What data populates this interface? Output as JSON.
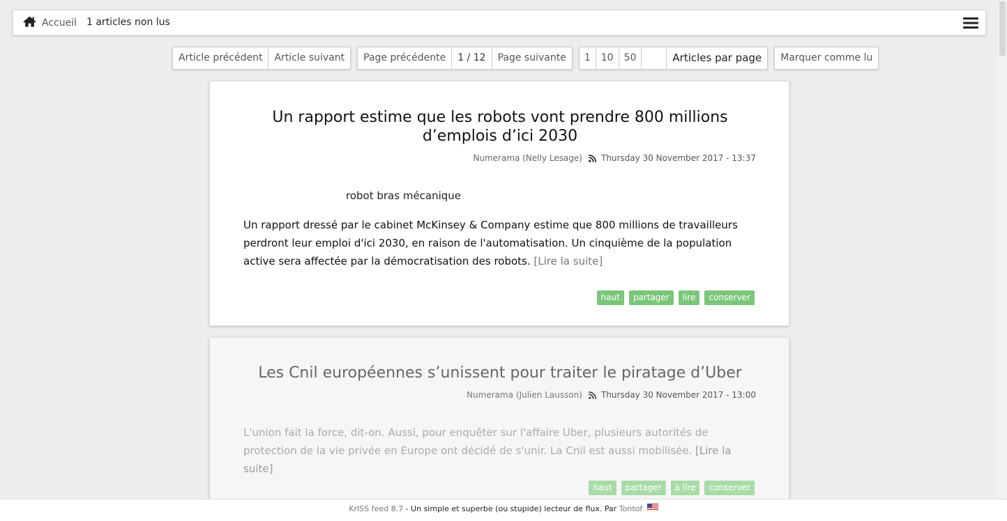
{
  "nav": {
    "home_label": "Accueil",
    "unread_label": "1 articles non lus"
  },
  "toolbar": {
    "prev_article": "Article précédent",
    "next_article": "Article suivant",
    "prev_page": "Page précédente",
    "page_indicator": "1 / 12",
    "next_page": "Page suivante",
    "per_page_options": [
      "1",
      "10",
      "50"
    ],
    "per_page_value": "",
    "per_page_label": "Articles par page",
    "mark_read": "Marquer comme lu"
  },
  "articles": [
    {
      "title": "Un rapport estime que les robots vont prendre 800 millions d’emplois d’ici 2030",
      "source": "Numerama (Nelly Lesage)",
      "date": "Thursday 30 November 2017 - 13:37",
      "image_alt": "robot bras mécanique",
      "text": "Un rapport dressé par le cabinet McKinsey & Company estime que 800 millions de travailleurs perdront leur emploi d'ici 2030, en raison de l'automatisation. Un cinquième de la population active sera affectée par la démocratisation des robots.",
      "more": "[Lire la suite]",
      "tags": [
        "haut",
        "partager",
        "lire",
        "conserver"
      ]
    },
    {
      "title": "Les Cnil européennes s’unissent pour traiter le piratage d’Uber",
      "source": "Numerama (Julien Lausson)",
      "date": "Thursday 30 November 2017 - 13:00",
      "text": "L'union fait la force, dit-on. Aussi, pour enquêter sur l'affaire Uber, plusieurs autorités de protection de la vie privée en Europe ont décidé de s'unir. La Cnil est aussi mobilisée.",
      "more": "[Lire la suite]",
      "tags": [
        "haut",
        "partager",
        "à lire",
        "conserver"
      ]
    }
  ],
  "footer": {
    "app_name": "KrISS feed 8.7",
    "text": " - Un simple et superbe (ou stupide) lecteur de flux. Par ",
    "author": "Tontof"
  },
  "colors": {
    "tag_green": "#7ac67a",
    "tag_green_read": "#a9dba9",
    "background": "#eeeeee"
  },
  "icons": [
    "home-icon",
    "hamburger-menu-icon",
    "rss-icon",
    "us-flag-icon"
  ]
}
